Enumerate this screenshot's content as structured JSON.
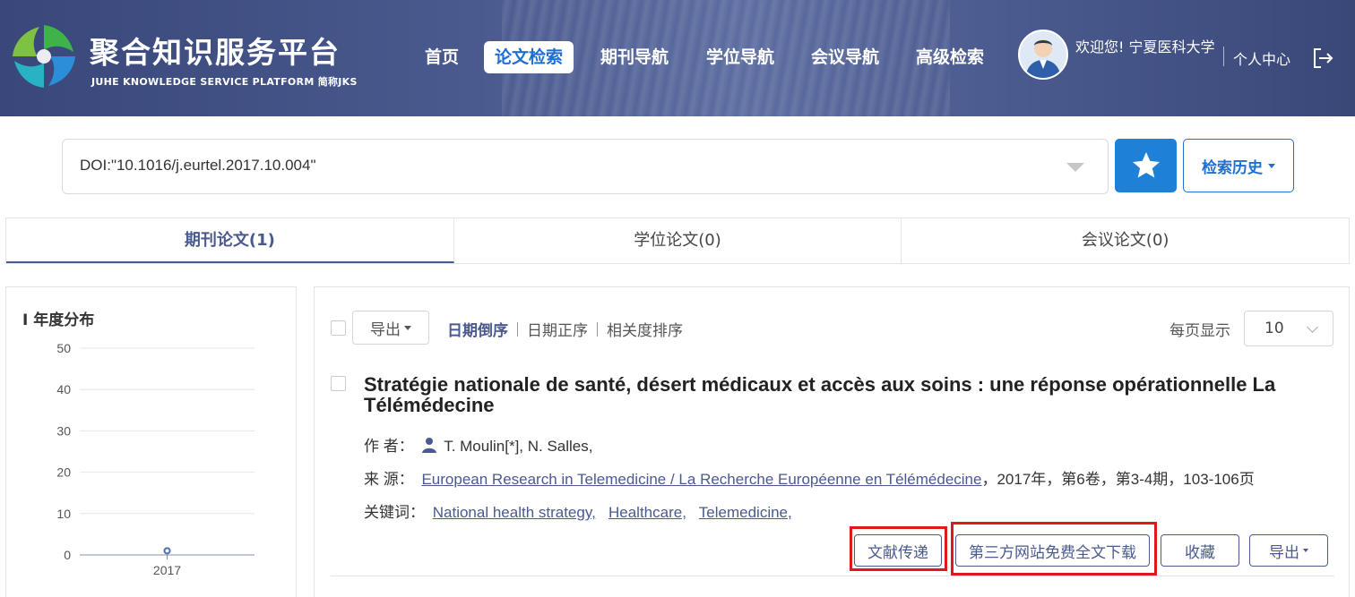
{
  "header": {
    "logo_title": "聚合知识服务平台",
    "logo_subtitle": "JUHE KNOWLEDGE SERVICE PLATFORM  简称JKS",
    "nav": [
      {
        "label": "首页",
        "active": false
      },
      {
        "label": "论文检索",
        "active": true
      },
      {
        "label": "期刊导航",
        "active": false
      },
      {
        "label": "学位导航",
        "active": false
      },
      {
        "label": "会议导航",
        "active": false
      },
      {
        "label": "高级检索",
        "active": false
      }
    ],
    "welcome": "欢迎您! 宁夏医科大学",
    "personal_center": "个人中心"
  },
  "search": {
    "query": "DOI:\"10.1016/j.eurtel.2017.10.004\"",
    "history_label": "检索历史"
  },
  "tabs": [
    {
      "label": "期刊论文(1)",
      "active": true
    },
    {
      "label": "学位论文(0)",
      "active": false
    },
    {
      "label": "会议论文(0)",
      "active": false
    }
  ],
  "sidebar": {
    "title": "I 年度分布",
    "chart_data": {
      "type": "line",
      "x": [
        "2017"
      ],
      "series": [
        {
          "values": [
            1
          ]
        }
      ],
      "ylim": [
        0,
        50
      ],
      "yticks": [
        0,
        10,
        20,
        30,
        40,
        50
      ],
      "grid": true
    }
  },
  "results": {
    "export_label": "导出",
    "sort": [
      {
        "label": "日期倒序",
        "active": true
      },
      {
        "label": "日期正序",
        "active": false
      },
      {
        "label": "相关度排序",
        "active": false
      }
    ],
    "per_page_label": "每页显示",
    "per_page_value": "10",
    "article": {
      "title": "Stratégie nationale de santé, désert médicaux et accès aux soins : une réponse opérationnelle La Télémédecine",
      "authors_label": "作 者：",
      "authors": "T. Moulin[*],   N. Salles,",
      "source_label": "来 源：",
      "source_journal": "European Research in Telemedicine / La Recherche Européenne en Télémédecine",
      "source_details": "，2017年，第6卷，第3-4期，103-106页",
      "keywords_label": "关键词：",
      "keywords": [
        "National health strategy,",
        "Healthcare,",
        "Telemedicine,"
      ],
      "actions": {
        "delivery": "文献传递",
        "third_party_download": "第三方网站免费全文下载",
        "favorite": "收藏",
        "export": "导出"
      }
    }
  },
  "colors": {
    "header_bg": "#4a5a8e",
    "accent_blue": "#1f80d8",
    "link": "#4a5a8e",
    "highlight_red": "#e0181b"
  }
}
